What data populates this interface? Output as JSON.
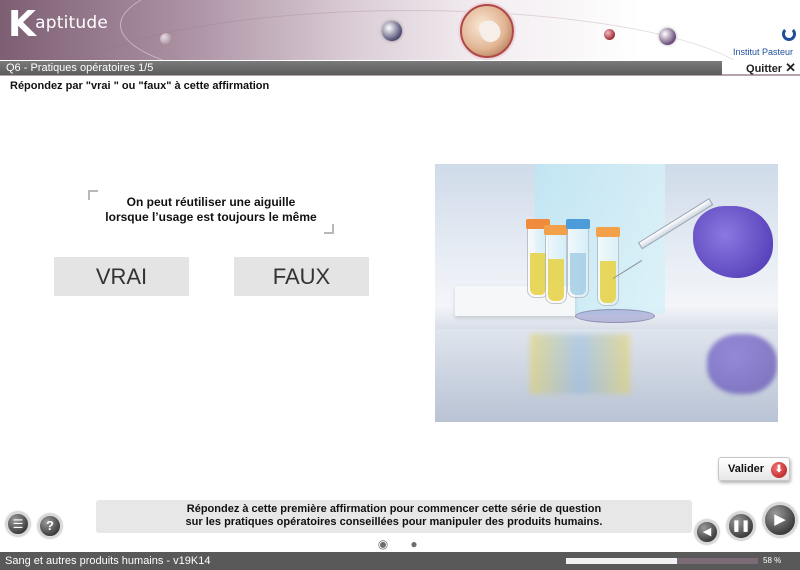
{
  "app": {
    "logo_initial": "K",
    "logo_rest": "aptitude",
    "partner": "Institut Pasteur"
  },
  "question": {
    "title": "Q6 - Pratiques opératoires 1/5",
    "quit_label": "Quitter",
    "instruction": "Répondez par \"vrai \" ou \"faux\" à cette affirmation",
    "statement_line1": "On peut réutiliser une aiguille",
    "statement_line2": "lorsque l’usage est toujours le même",
    "answers": [
      {
        "label": "VRAI"
      },
      {
        "label": "FAUX"
      }
    ],
    "validate_label": "Valider"
  },
  "help": {
    "line1": "Répondez à cette première affirmation pour commencer cette série de question",
    "line2": "sur les pratiques opératoires conseillées pour manipuler des produits humains."
  },
  "footer": {
    "course_title": "Sang et autres produits humains - v19K14",
    "progress_percent": 58,
    "progress_label": "58 %"
  },
  "icons": {
    "menu": "list-icon",
    "help": "question-icon",
    "prev": "chevron-left-icon",
    "pause": "pause-icon",
    "next": "play-icon",
    "audio": "speaker-icon",
    "chat": "chat-bubble-icon",
    "close": "close-icon"
  },
  "colors": {
    "header_accent": "#7d5f73",
    "validate_red": "#b01818",
    "footer_bg": "#595959"
  }
}
